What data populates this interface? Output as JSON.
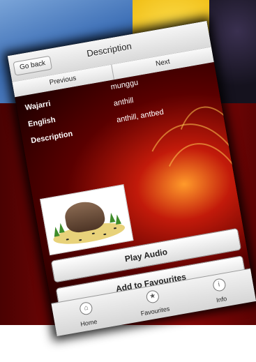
{
  "header": {
    "back_label": "Go back",
    "title": "Description",
    "previous_label": "Previous",
    "next_label": "Next"
  },
  "entry": {
    "wajarri_label": "Wajarri",
    "wajarri_value": "munggu",
    "english_label": "English",
    "english_value": "anthill",
    "description_label": "Description",
    "description_value": "anthill, antbed"
  },
  "actions": {
    "play_audio_label": "Play Audio",
    "add_favourites_label": "Add to Favourites"
  },
  "tabs": [
    {
      "label": "Home",
      "icon": "home-icon"
    },
    {
      "label": "Favourites",
      "icon": "star-icon"
    },
    {
      "label": "Info",
      "icon": "info-icon"
    }
  ]
}
